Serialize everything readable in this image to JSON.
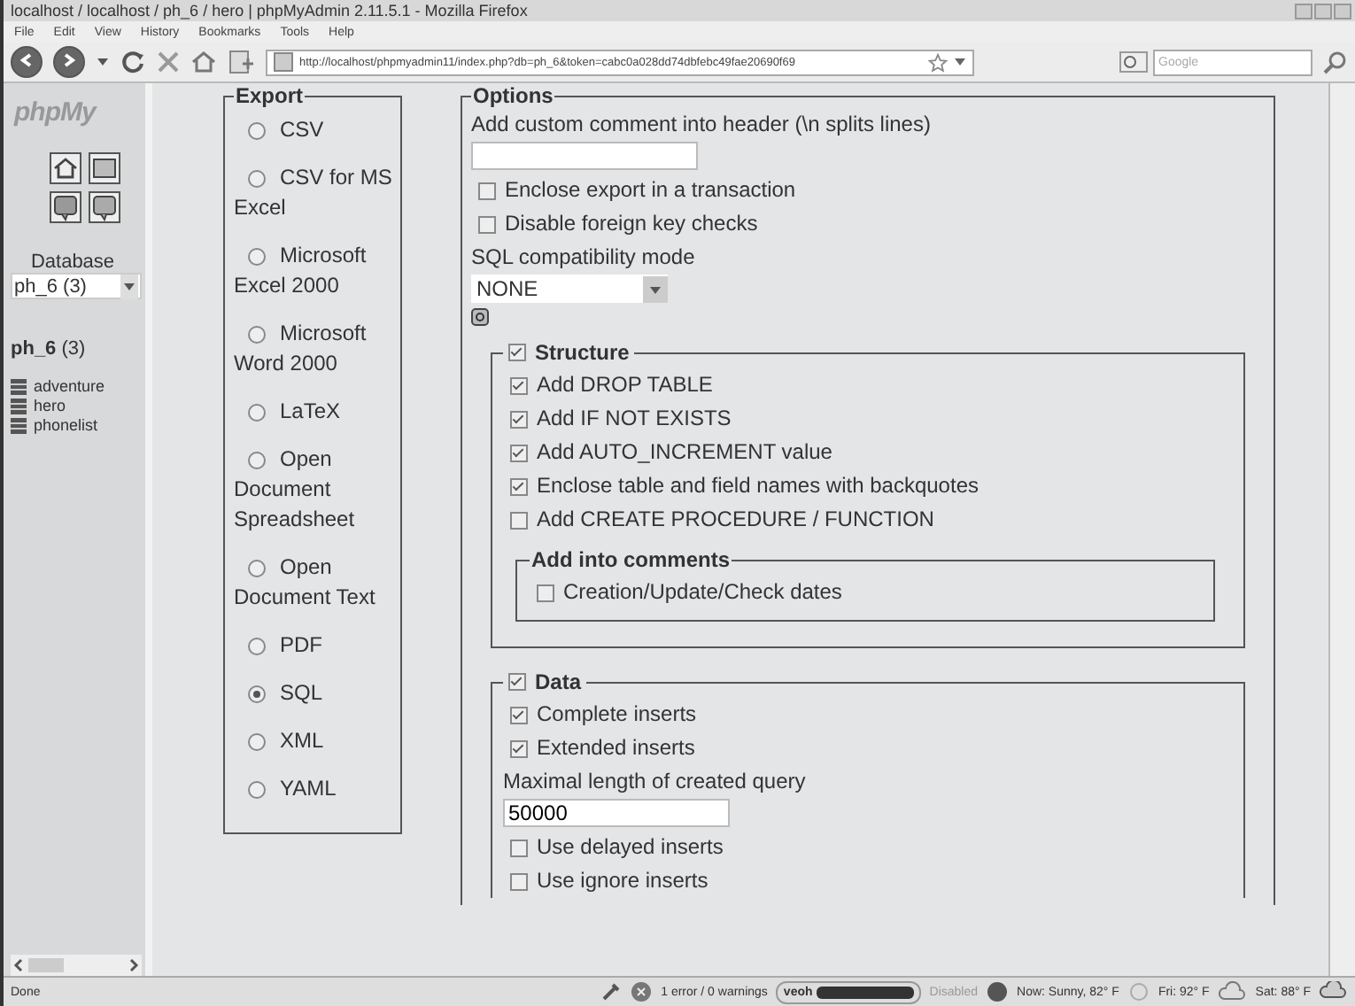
{
  "window": {
    "title": "localhost / localhost / ph_6 / hero | phpMyAdmin 2.11.5.1 - Mozilla Firefox"
  },
  "menu": [
    "File",
    "Edit",
    "View",
    "History",
    "Bookmarks",
    "Tools",
    "Help"
  ],
  "address": {
    "value": "http://localhost/phpmyadmin11/index.php?db=ph_6&token=cabc0a028dd74dbfebc49fae20690f69"
  },
  "search": {
    "placeholder": "Google"
  },
  "sidebar": {
    "logo": "phpMy",
    "database_label": "Database",
    "database_value": "ph_6 (3)",
    "db_name": "ph_6",
    "db_count": "(3)",
    "tables": [
      {
        "name": "adventure"
      },
      {
        "name": "hero"
      },
      {
        "name": "phonelist"
      }
    ]
  },
  "export": {
    "legend": "Export",
    "formats": [
      {
        "label": "CSV",
        "selected": false
      },
      {
        "label": "CSV for MS Excel",
        "selected": false
      },
      {
        "label": "Microsoft Excel 2000",
        "selected": false
      },
      {
        "label": "Microsoft Word 2000",
        "selected": false
      },
      {
        "label": "LaTeX",
        "selected": false
      },
      {
        "label": "Open Document Spreadsheet",
        "selected": false
      },
      {
        "label": "Open Document Text",
        "selected": false
      },
      {
        "label": "PDF",
        "selected": false
      },
      {
        "label": "SQL",
        "selected": true
      },
      {
        "label": "XML",
        "selected": false
      },
      {
        "label": "YAML",
        "selected": false
      }
    ]
  },
  "options": {
    "legend": "Options",
    "comment_label": "Add custom comment into header (\\n splits lines)",
    "general": [
      {
        "label": "Enclose export in a transaction",
        "checked": false
      },
      {
        "label": "Disable foreign key checks",
        "checked": false
      }
    ],
    "compat_label": "SQL compatibility mode",
    "compat_value": "NONE",
    "structure": {
      "legend": "Structure",
      "checked": true,
      "items": [
        {
          "label": "Add DROP TABLE",
          "checked": true
        },
        {
          "label": "Add IF NOT EXISTS",
          "checked": true
        },
        {
          "label": "Add AUTO_INCREMENT value",
          "checked": true
        },
        {
          "label": "Enclose table and field names with backquotes",
          "checked": true
        },
        {
          "label": "Add CREATE PROCEDURE / FUNCTION",
          "checked": false
        }
      ],
      "comments": {
        "legend": "Add into comments",
        "items": [
          {
            "label": "Creation/Update/Check dates",
            "checked": false
          }
        ]
      }
    },
    "data": {
      "legend": "Data",
      "checked": true,
      "items_before": [
        {
          "label": "Complete inserts",
          "checked": true
        },
        {
          "label": "Extended inserts",
          "checked": true
        }
      ],
      "max_label": "Maximal length of created query",
      "max_value": "50000",
      "items_after": [
        {
          "label": "Use delayed inserts",
          "checked": false
        },
        {
          "label": "Use ignore inserts",
          "checked": false
        }
      ]
    }
  },
  "status_bar": {
    "text": "Done",
    "errors": "1 error / 0 warnings",
    "toolbar": "veoh",
    "disabled": "Disabled",
    "weather_now": "Now: Sunny, 82° F",
    "weather_fri": "Fri: 92° F",
    "weather_sat": "Sat: 88° F"
  }
}
